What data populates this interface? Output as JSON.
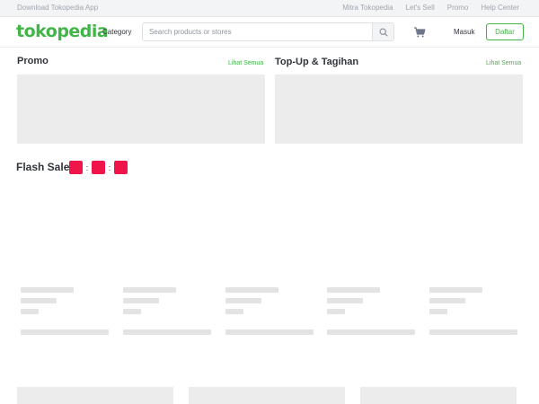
{
  "topbar": {
    "download_app": "Download Tokopedia App",
    "links": [
      "Mitra Tokopedia",
      "Let's Sell",
      "Promo",
      "Help Center"
    ]
  },
  "header": {
    "logo": "tokopedia",
    "category": "Category",
    "search_placeholder": "Search products or stores",
    "login": "Masuk",
    "register": "Daftar"
  },
  "promo": {
    "title": "Promo",
    "see_all": "Lihat Semua"
  },
  "topup": {
    "title": "Top-Up & Tagihan",
    "see_all": "Lihat Semua"
  },
  "flash_sale": {
    "title": "Flash Sale",
    "separator": ":"
  },
  "colors": {
    "brand": "#42b549",
    "timer": "#ef144a",
    "skeleton": "#e3e3e3"
  },
  "icons": {
    "search": "search-icon",
    "cart": "cart-icon"
  }
}
